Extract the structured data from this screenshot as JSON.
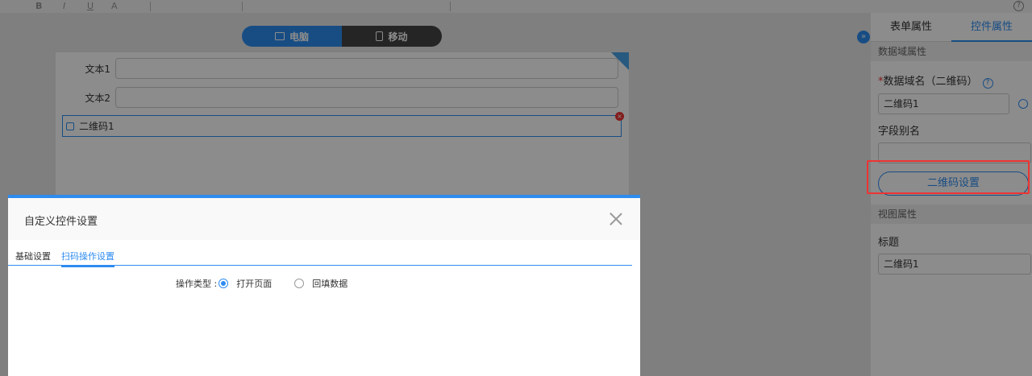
{
  "toolbar": {
    "items": [
      "B",
      "I",
      "U",
      "A"
    ],
    "help_icon": "question-circle-icon"
  },
  "device_switch": {
    "pc_label": "电脑",
    "mobile_label": "移动"
  },
  "form": {
    "fields": [
      {
        "label": "文本1"
      },
      {
        "label": "文本2"
      }
    ],
    "qr_field_label": "二维码1"
  },
  "right_panel": {
    "tabs": [
      "表单属性",
      "控件属性"
    ],
    "active_tab": "控件属性",
    "data_section": "数据域属性",
    "data_name_label": "数据域名（二维码）",
    "data_name_value": "二维码1",
    "alias_label": "字段别名",
    "alias_value": "",
    "qr_setting_button": "二维码设置",
    "view_section": "视图属性",
    "title_label": "标题",
    "title_value": "二维码1"
  },
  "modal": {
    "title": "自定义控件设置",
    "tabs": [
      "基础设置",
      "扫码操作设置"
    ],
    "active_tab": "扫码操作设置",
    "operation_label": "操作类型 :",
    "options": [
      "打开页面",
      "回填数据"
    ],
    "selected_option": "打开页面"
  },
  "colors": {
    "accent": "#2d8cf0",
    "highlight": "#e33333"
  }
}
